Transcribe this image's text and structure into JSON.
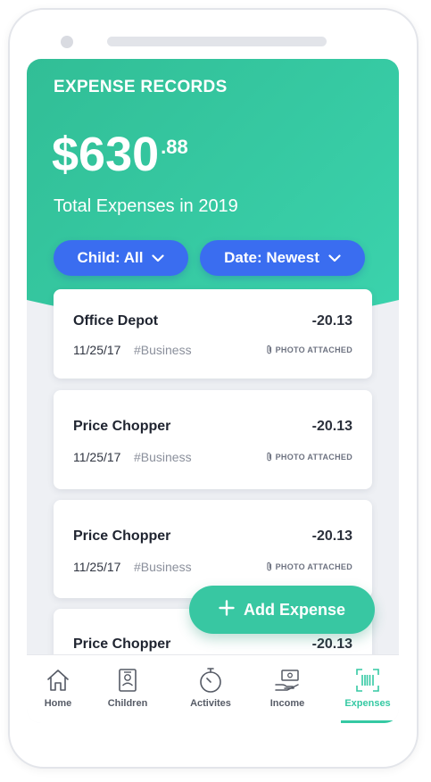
{
  "header": {
    "title": "EXPENSE RECORDS",
    "amount_main": "$630",
    "amount_cents": ".88",
    "subtitle": "Total Expenses in 2019"
  },
  "filters": {
    "child_label": "Child: All",
    "date_label": "Date: Newest"
  },
  "records": [
    {
      "vendor": "Office Depot",
      "amount": "-20.13",
      "date": "11/25/17",
      "tag": "#Business",
      "attachment": "PHOTO ATTACHED"
    },
    {
      "vendor": "Price Chopper",
      "amount": "-20.13",
      "date": "11/25/17",
      "tag": "#Business",
      "attachment": "PHOTO ATTACHED"
    },
    {
      "vendor": "Price Chopper",
      "amount": "-20.13",
      "date": "11/25/17",
      "tag": "#Business",
      "attachment": "PHOTO ATTACHED"
    },
    {
      "vendor": "Price Chopper",
      "amount": "-20.13"
    }
  ],
  "fab": {
    "label": "Add Expense",
    "icon": "plus-icon"
  },
  "tabs": [
    {
      "label": "Home",
      "icon": "home-icon"
    },
    {
      "label": "Children",
      "icon": "child-id-icon"
    },
    {
      "label": "Activites",
      "icon": "stopwatch-icon"
    },
    {
      "label": "Income",
      "icon": "cash-hand-icon"
    },
    {
      "label": "Expenses",
      "icon": "barcode-icon",
      "active": true
    }
  ],
  "colors": {
    "header_gradient_start": "#31be96",
    "header_gradient_end": "#3bd3ad",
    "filter_button": "#3a6df0",
    "fab": "#38c7a2",
    "active_tab": "#35c9a3"
  }
}
